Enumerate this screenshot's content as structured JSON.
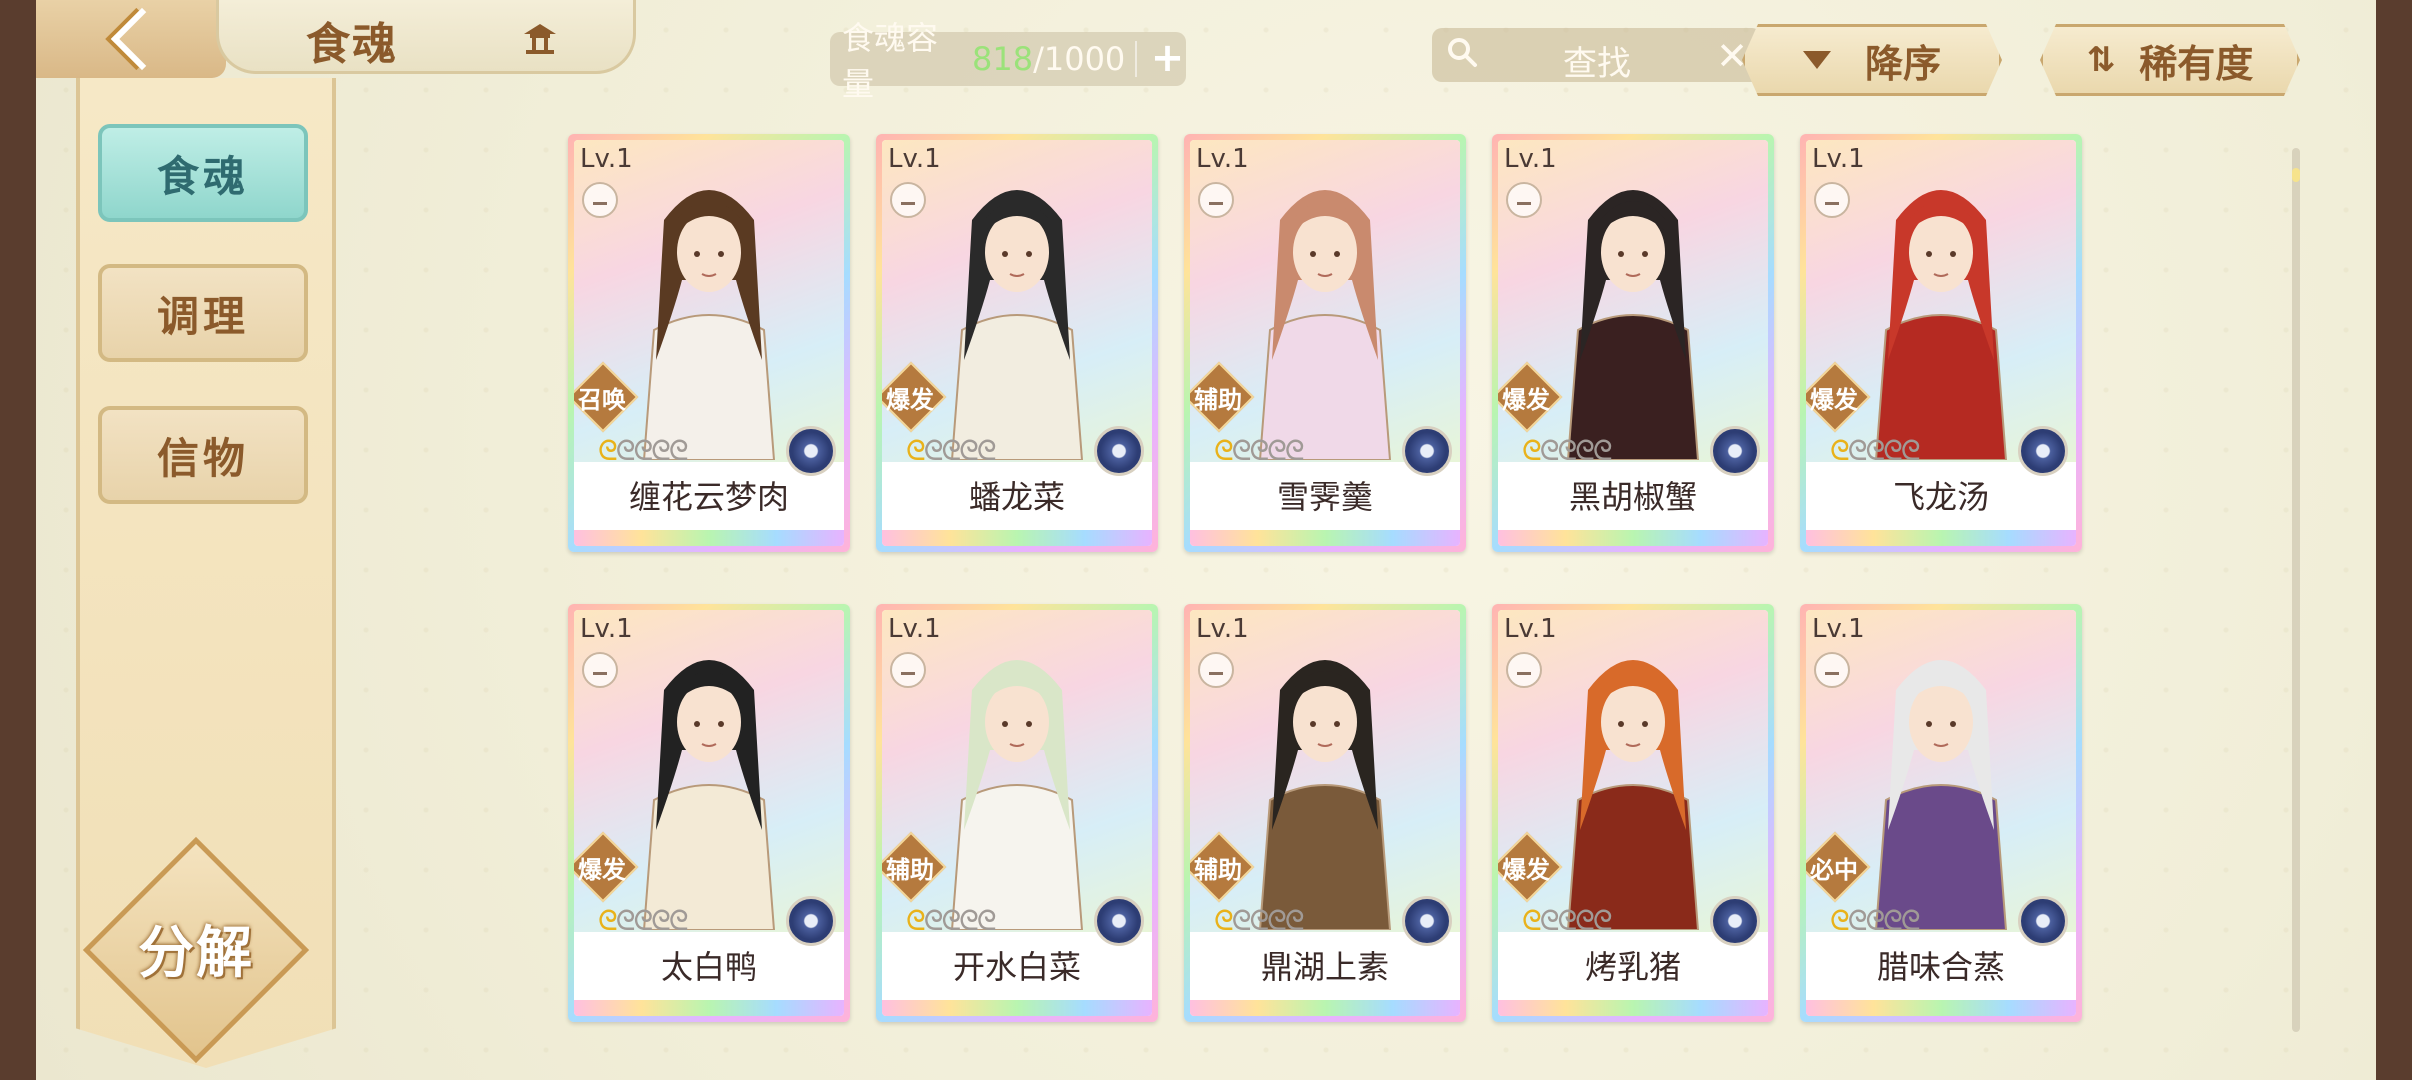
{
  "header": {
    "title": "食魂",
    "capacity_label": "食魂容量",
    "capacity_current": "818",
    "capacity_max": "/1000",
    "capacity_add": "+",
    "search_placeholder": "查找",
    "search_clear": "✕",
    "sort_order_label": "降序",
    "sort_by_label": "稀有度"
  },
  "sidebar": {
    "items": [
      {
        "label": "食魂",
        "active": true
      },
      {
        "label": "调理",
        "active": false
      },
      {
        "label": "信物",
        "active": false
      }
    ],
    "decompose_label": "分解"
  },
  "cards": [
    {
      "level": "Lv.1",
      "role": "召唤",
      "name": "缠花云梦肉",
      "stars_filled": 1,
      "stars_total": 5,
      "hair": "#5a3a22",
      "robe": "#f4f0ea"
    },
    {
      "level": "Lv.1",
      "role": "爆发",
      "name": "蟠龙菜",
      "stars_filled": 1,
      "stars_total": 5,
      "hair": "#2a2a2a",
      "robe": "#f2ede0"
    },
    {
      "level": "Lv.1",
      "role": "辅助",
      "name": "雪霁羹",
      "stars_filled": 1,
      "stars_total": 5,
      "hair": "#c98a6e",
      "robe": "#f0d9e8"
    },
    {
      "level": "Lv.1",
      "role": "爆发",
      "name": "黑胡椒蟹",
      "stars_filled": 1,
      "stars_total": 5,
      "hair": "#2b2524",
      "robe": "#3a2020"
    },
    {
      "level": "Lv.1",
      "role": "爆发",
      "name": "飞龙汤",
      "stars_filled": 1,
      "stars_total": 5,
      "hair": "#c8382a",
      "robe": "#b52a22"
    },
    {
      "level": "Lv.1",
      "role": "爆发",
      "name": "太白鸭",
      "stars_filled": 1,
      "stars_total": 5,
      "hair": "#222222",
      "robe": "#f3ead6"
    },
    {
      "level": "Lv.1",
      "role": "辅助",
      "name": "开水白菜",
      "stars_filled": 1,
      "stars_total": 5,
      "hair": "#d9e6c8",
      "robe": "#f6f4ee"
    },
    {
      "level": "Lv.1",
      "role": "辅助",
      "name": "鼎湖上素",
      "stars_filled": 1,
      "stars_total": 5,
      "hair": "#2a2520",
      "robe": "#7a5a3a"
    },
    {
      "level": "Lv.1",
      "role": "爆发",
      "name": "烤乳猪",
      "stars_filled": 1,
      "stars_total": 5,
      "hair": "#d86a2a",
      "robe": "#8a2a1a"
    },
    {
      "level": "Lv.1",
      "role": "必中",
      "name": "腊味合蒸",
      "stars_filled": 1,
      "stars_total": 5,
      "hair": "#e8e8e8",
      "robe": "#6a4a8a"
    }
  ]
}
